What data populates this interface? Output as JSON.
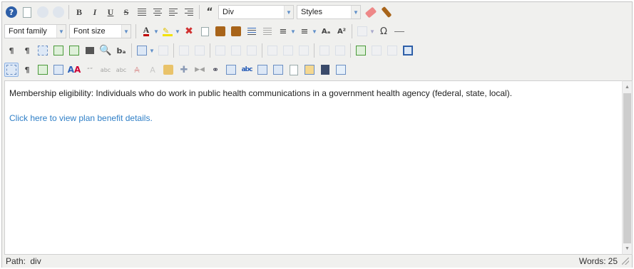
{
  "toolbar": {
    "format_select": "Div",
    "styles_select": "Styles",
    "font_family_select": "Font family",
    "font_size_select": "Font size",
    "quote_label": "“",
    "paragraph_mark": "¶",
    "ltr_mark": "¶",
    "omega": "Ω",
    "ba_label": "bₐ",
    "aa_label": "Aₐ",
    "asup_label": "A²",
    "text_color_glyph": "A",
    "sub_a": "A",
    "colors": {
      "accent": "#2f7fc7",
      "font_color_bar": "#c00000",
      "highlight_bar": "#f2e200"
    }
  },
  "content": {
    "paragraph1": "Membership eligibility:  Individuals who do work in public health communications in a government health agency (federal, state, local).",
    "link_text": "Click here to view plan benefit details."
  },
  "statusbar": {
    "path_label": "Path:",
    "path_value": "div",
    "words_label": "Words:",
    "words_value": "25"
  }
}
